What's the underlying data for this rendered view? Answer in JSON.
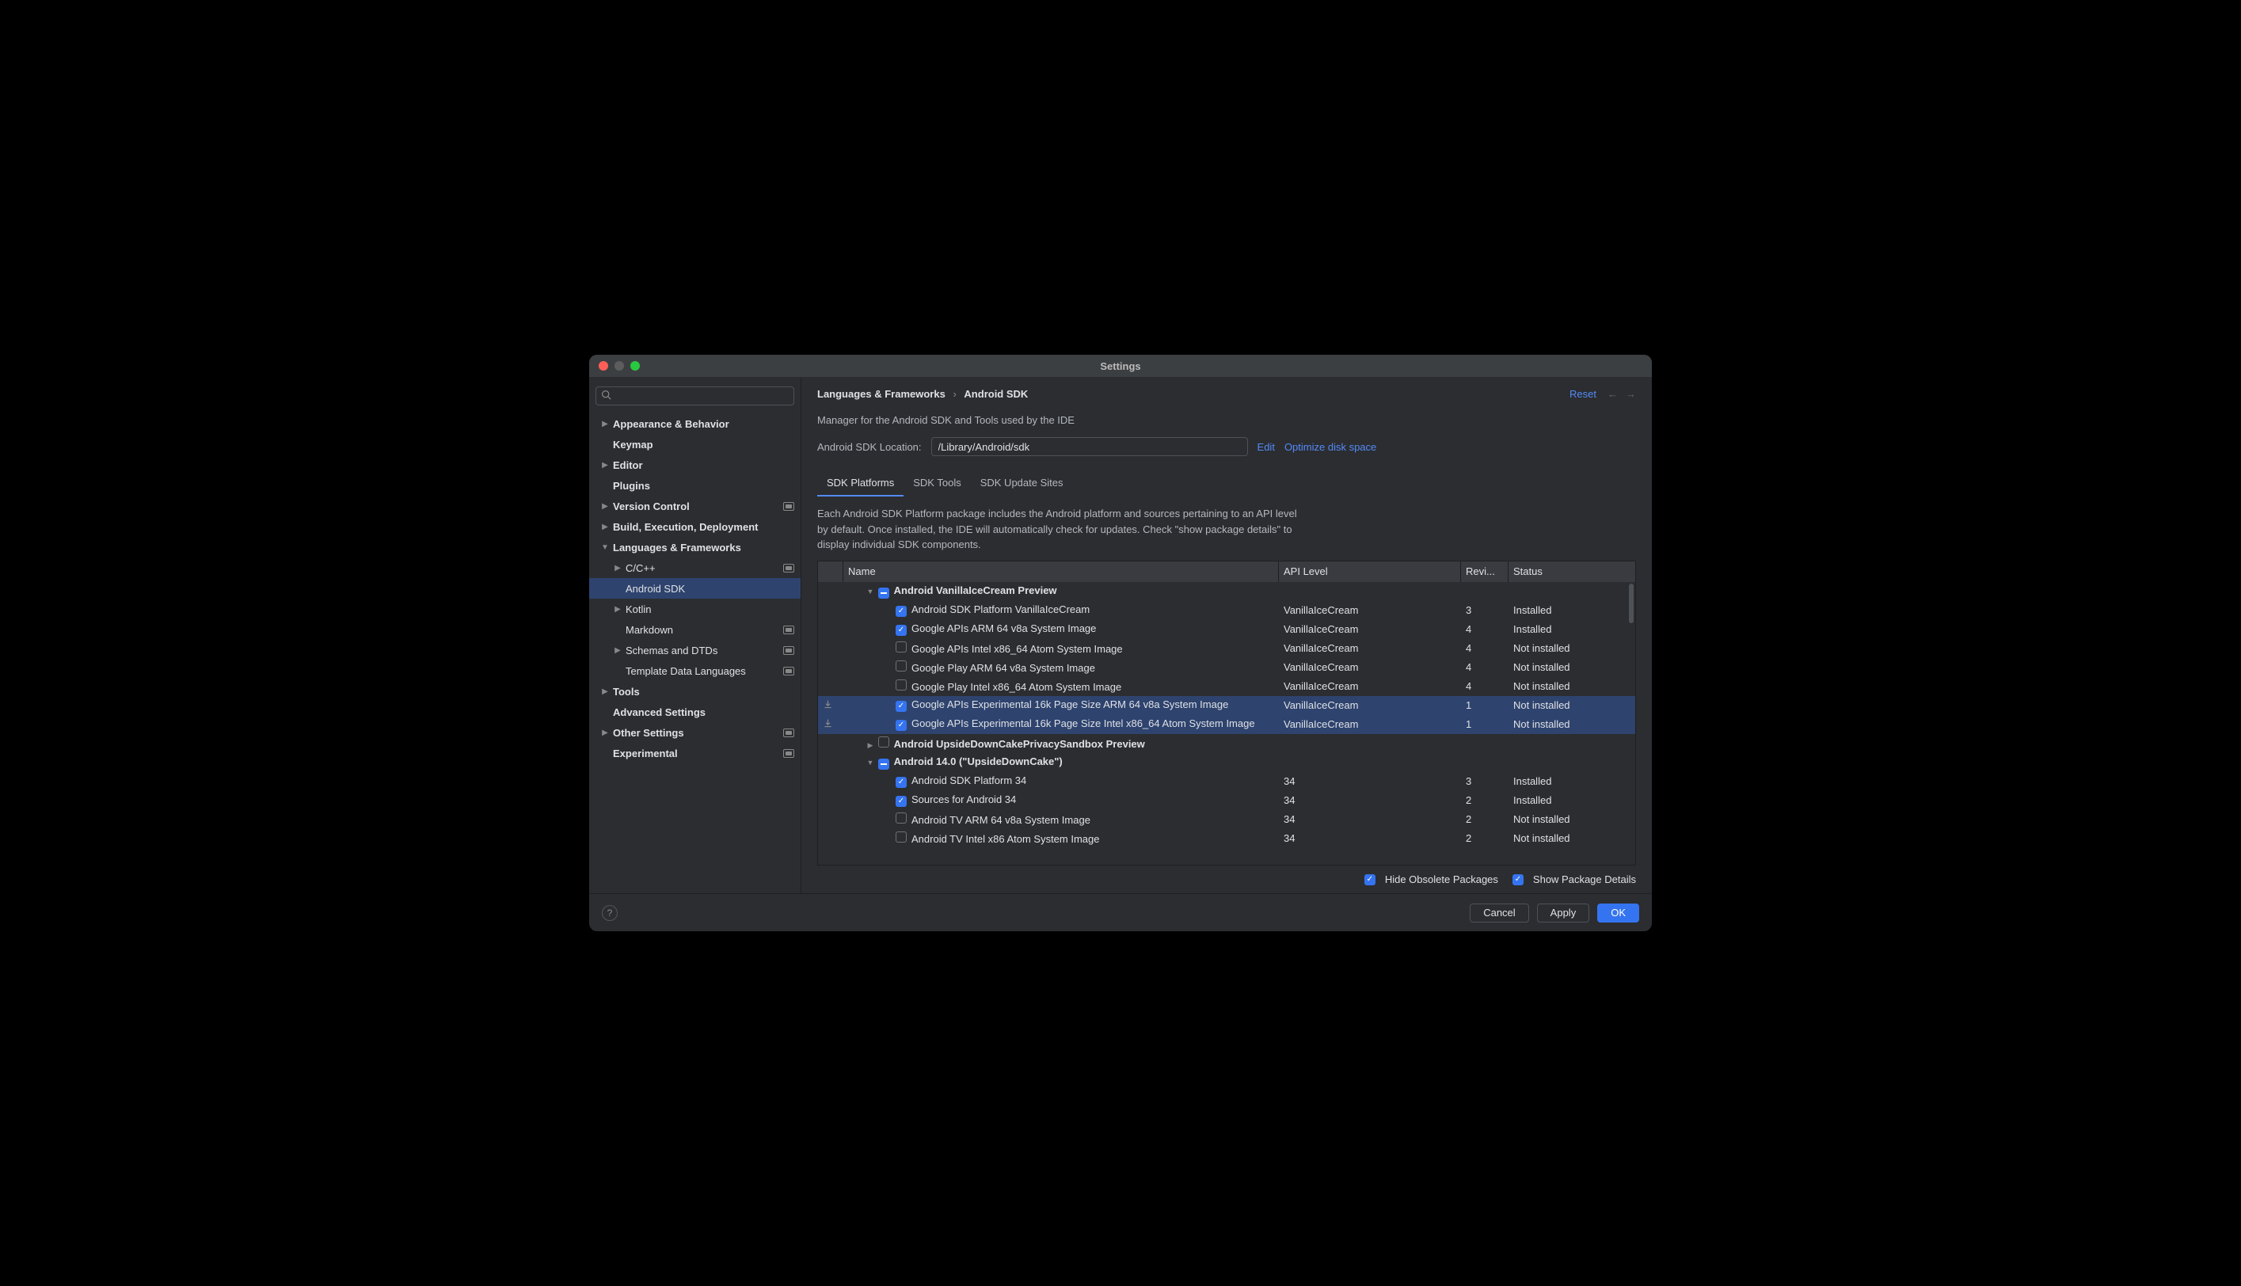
{
  "window": {
    "title": "Settings"
  },
  "header": {
    "breadcrumb_root": "Languages & Frameworks",
    "breadcrumb_leaf": "Android SDK",
    "reset": "Reset"
  },
  "sidebar": {
    "search_placeholder": "",
    "items": [
      {
        "label": "Appearance & Behavior",
        "indent": 0,
        "chevron": "right",
        "badge": false
      },
      {
        "label": "Keymap",
        "indent": 0,
        "chevron": "",
        "badge": false
      },
      {
        "label": "Editor",
        "indent": 0,
        "chevron": "right",
        "badge": false
      },
      {
        "label": "Plugins",
        "indent": 0,
        "chevron": "",
        "badge": false
      },
      {
        "label": "Version Control",
        "indent": 0,
        "chevron": "right",
        "badge": true
      },
      {
        "label": "Build, Execution, Deployment",
        "indent": 0,
        "chevron": "right",
        "badge": false
      },
      {
        "label": "Languages & Frameworks",
        "indent": 0,
        "chevron": "down",
        "badge": false
      },
      {
        "label": "C/C++",
        "indent": 1,
        "chevron": "right",
        "badge": true
      },
      {
        "label": "Android SDK",
        "indent": 1,
        "chevron": "",
        "badge": false,
        "selected": true
      },
      {
        "label": "Kotlin",
        "indent": 1,
        "chevron": "right",
        "badge": false
      },
      {
        "label": "Markdown",
        "indent": 1,
        "chevron": "",
        "badge": true
      },
      {
        "label": "Schemas and DTDs",
        "indent": 1,
        "chevron": "right",
        "badge": true
      },
      {
        "label": "Template Data Languages",
        "indent": 1,
        "chevron": "",
        "badge": true
      },
      {
        "label": "Tools",
        "indent": 0,
        "chevron": "right",
        "badge": false
      },
      {
        "label": "Advanced Settings",
        "indent": 0,
        "chevron": "",
        "badge": false
      },
      {
        "label": "Other Settings",
        "indent": 0,
        "chevron": "right",
        "badge": true
      },
      {
        "label": "Experimental",
        "indent": 0,
        "chevron": "",
        "badge": true
      }
    ]
  },
  "content": {
    "subtitle": "Manager for the Android SDK and Tools used by the IDE",
    "location_label": "Android SDK Location:",
    "location_value": "/Library/Android/sdk",
    "edit": "Edit",
    "optimize": "Optimize disk space",
    "tabs": [
      {
        "label": "SDK Platforms",
        "active": true
      },
      {
        "label": "SDK Tools",
        "active": false
      },
      {
        "label": "SDK Update Sites",
        "active": false
      }
    ],
    "description": "Each Android SDK Platform package includes the Android platform and sources pertaining to an API level by default. Once installed, the IDE will automatically check for updates. Check \"show package details\" to display individual SDK components.",
    "columns": {
      "name": "Name",
      "api": "API Level",
      "rev": "Revi...",
      "status": "Status"
    },
    "rows": [
      {
        "type": "group",
        "expanded": true,
        "check": "partial",
        "name": "Android VanillaIceCream Preview"
      },
      {
        "type": "item",
        "check": "checked",
        "name": "Android SDK Platform VanillaIceCream",
        "api": "VanillaIceCream",
        "rev": "3",
        "status": "Installed"
      },
      {
        "type": "item",
        "check": "checked",
        "name": "Google APIs ARM 64 v8a System Image",
        "api": "VanillaIceCream",
        "rev": "4",
        "status": "Installed"
      },
      {
        "type": "item",
        "check": "",
        "name": "Google APIs Intel x86_64 Atom System Image",
        "api": "VanillaIceCream",
        "rev": "4",
        "status": "Not installed"
      },
      {
        "type": "item",
        "check": "",
        "name": "Google Play ARM 64 v8a System Image",
        "api": "VanillaIceCream",
        "rev": "4",
        "status": "Not installed"
      },
      {
        "type": "item",
        "check": "",
        "name": "Google Play Intel x86_64 Atom System Image",
        "api": "VanillaIceCream",
        "rev": "4",
        "status": "Not installed"
      },
      {
        "type": "item",
        "check": "checked",
        "mark": "dl",
        "selected": true,
        "name": "Google APIs Experimental 16k Page Size ARM 64 v8a System Image",
        "api": "VanillaIceCream",
        "rev": "1",
        "status": "Not installed"
      },
      {
        "type": "item",
        "check": "checked",
        "mark": "dl",
        "selected": true,
        "name": "Google APIs Experimental 16k Page Size Intel x86_64 Atom System Image",
        "api": "VanillaIceCream",
        "rev": "1",
        "status": "Not installed"
      },
      {
        "type": "group",
        "expanded": false,
        "check": "",
        "name": "Android UpsideDownCakePrivacySandbox Preview"
      },
      {
        "type": "group",
        "expanded": true,
        "check": "partial",
        "name": "Android 14.0 (\"UpsideDownCake\")"
      },
      {
        "type": "item",
        "check": "checked",
        "name": "Android SDK Platform 34",
        "api": "34",
        "rev": "3",
        "status": "Installed"
      },
      {
        "type": "item",
        "check": "checked",
        "name": "Sources for Android 34",
        "api": "34",
        "rev": "2",
        "status": "Installed"
      },
      {
        "type": "item",
        "check": "",
        "name": "Android TV ARM 64 v8a System Image",
        "api": "34",
        "rev": "2",
        "status": "Not installed"
      },
      {
        "type": "item",
        "check": "",
        "name": "Android TV Intel x86 Atom System Image",
        "api": "34",
        "rev": "2",
        "status": "Not installed"
      }
    ],
    "hide_obsolete": "Hide Obsolete Packages",
    "show_details": "Show Package Details"
  },
  "footer": {
    "cancel": "Cancel",
    "apply": "Apply",
    "ok": "OK"
  }
}
